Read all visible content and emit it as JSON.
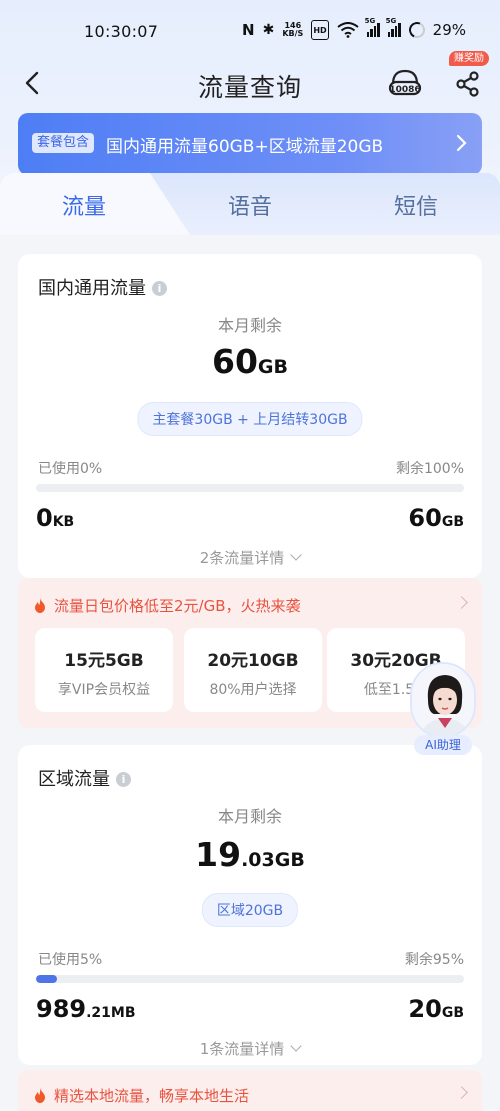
{
  "status_bar": {
    "time": "10:30:07",
    "nfc": "N",
    "bluetooth": "✱",
    "speed_value": "146",
    "speed_unit": "KB/S",
    "hd": "HD",
    "sig1": "5G",
    "sig2": "5G",
    "battery": "29%"
  },
  "header": {
    "title": "流量查询",
    "earn_badge": "赚奖励"
  },
  "banner": {
    "tag": "套餐包含",
    "text": "国内通用流量60GB+区域流量20GB"
  },
  "tabs": [
    "流量",
    "语音",
    "短信"
  ],
  "cards": [
    {
      "title": "国内通用流量",
      "remaining_label": "本月剩余",
      "remaining_int": "60",
      "remaining_dec": "",
      "remaining_unit": "GB",
      "pill": "主套餐30GB + 上月结转30GB",
      "used_label": "已使用0%",
      "left_label": "剩余100%",
      "used_fraction": 0,
      "used_amount": "0",
      "used_unit": "KB",
      "total_amount": "60",
      "total_unit": "GB",
      "details": "2条流量详情"
    },
    {
      "title": "区域流量",
      "remaining_label": "本月剩余",
      "remaining_int": "19",
      "remaining_dec": ".03",
      "remaining_unit": "GB",
      "pill": "区域20GB",
      "used_label": "已使用5%",
      "left_label": "剩余95%",
      "used_fraction": 0.05,
      "used_amount": "989",
      "used_dec": ".21",
      "used_unit": "MB",
      "total_amount": "20",
      "total_unit": "GB",
      "details": "1条流量详情"
    }
  ],
  "promo": {
    "headline": "流量日包价格低至2元/GB，火热来袭",
    "packages": [
      {
        "name": "15元5GB",
        "desc": "享VIP会员权益"
      },
      {
        "name": "20元10GB",
        "desc": "80%用户选择"
      },
      {
        "name": "30元20GB",
        "desc": "低至1.5元"
      }
    ]
  },
  "promo2": {
    "headline": "精选本地流量，畅享本地生活"
  },
  "ai_assistant": {
    "label": "AI助理"
  },
  "colors": {
    "accent": "#3a6be8",
    "banner": "#5a83f5",
    "promo_red": "#e8533f"
  }
}
